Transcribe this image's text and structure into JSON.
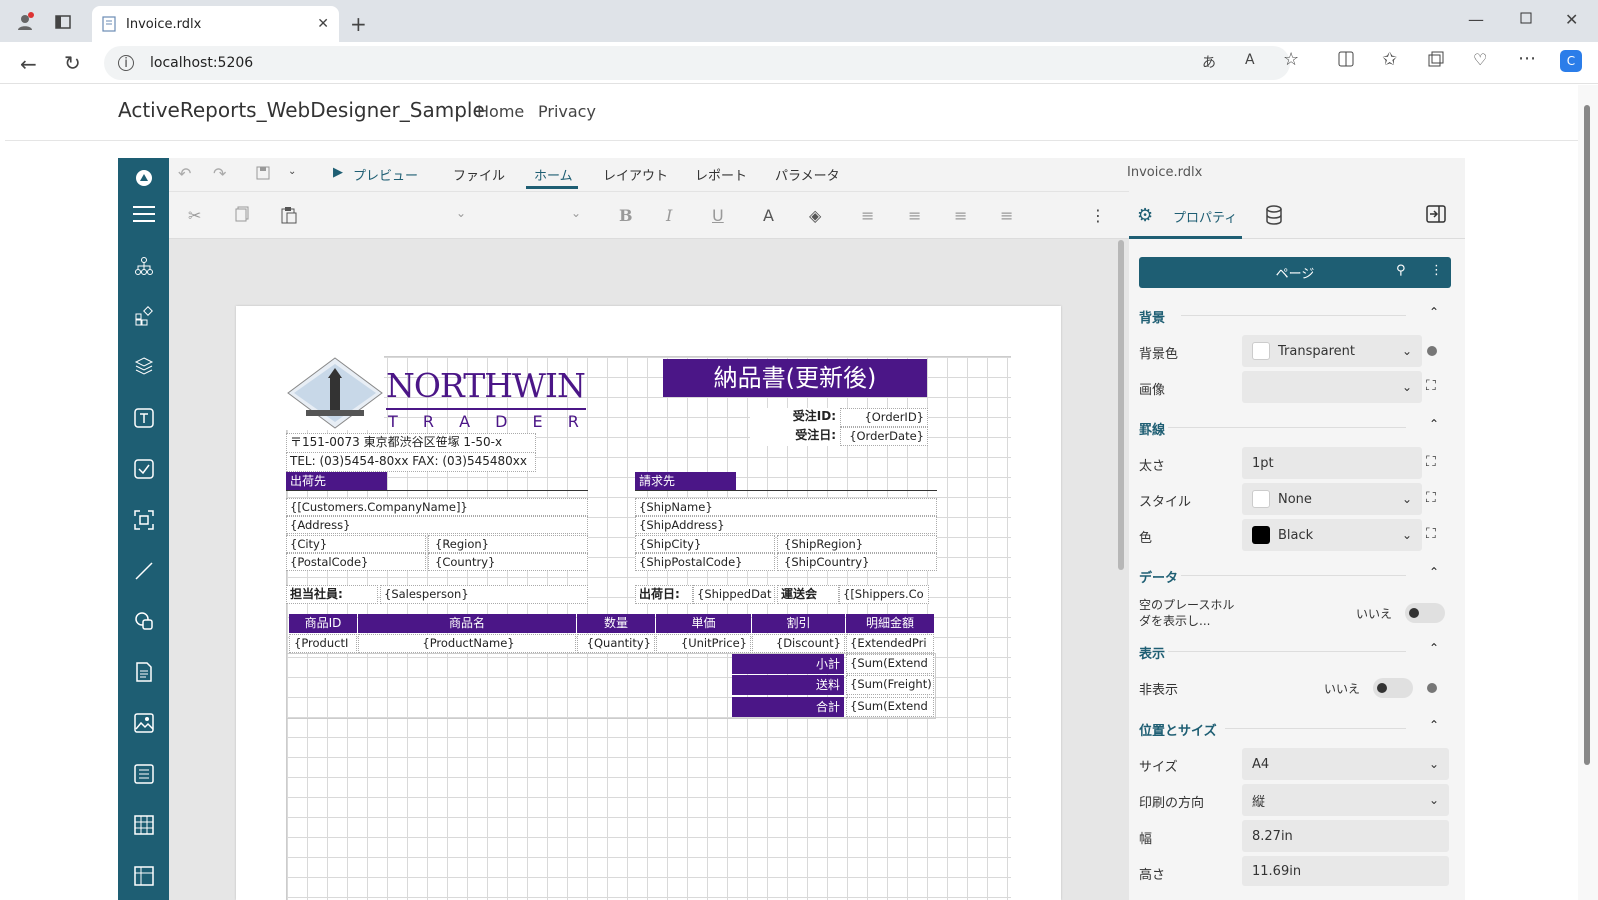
{
  "browser": {
    "tab_title": "Invoice.rdlx",
    "url": "localhost:5206"
  },
  "site": {
    "brand": "ActiveReports_WebDesigner_Sample",
    "nav": [
      "Home",
      "Privacy"
    ]
  },
  "designer": {
    "file_name": "Invoice.rdlx",
    "preview": "プレビュー",
    "menu": [
      "ファイル",
      "ホーム",
      "レイアウト",
      "レポート",
      "パラメータ"
    ],
    "active_menu": "ホーム",
    "properties_tab": "プロパティ"
  },
  "report": {
    "title": "納品書(更新後)",
    "logo_main": "NORTHWIND",
    "logo_sub": "T R A D E R S",
    "address": "〒151-0073 東京都渋谷区笹塚 1-50-x",
    "tel": "TEL: (03)5454-80xx FAX: (03)545480xx",
    "order_id_label": "受注ID:",
    "order_id": "{OrderID}",
    "order_date_label": "受注日:",
    "order_date": "{OrderDate}",
    "ship_to": "出荷先",
    "bill_to": "請求先",
    "company": "{[Customers.CompanyName]}",
    "addr": "{Address}",
    "city": "{City}",
    "region": "{Region}",
    "postal": "{PostalCode}",
    "country": "{Country}",
    "ship_name": "{ShipName}",
    "ship_address": "{ShipAddress}",
    "ship_city": "{ShipCity}",
    "ship_region": "{ShipRegion}",
    "ship_postal": "{ShipPostalCode}",
    "ship_country": "{ShipCountry}",
    "salesperson_label": "担当社員:",
    "salesperson": "{Salesperson}",
    "shipped_label": "出荷日:",
    "shipped": "{ShippedDat",
    "shipper_label": "運送会",
    "shipper": "{[Shippers.Co",
    "columns": [
      "商品ID",
      "商品名",
      "数量",
      "単価",
      "割引",
      "明細金額"
    ],
    "cells": [
      "{ProductI",
      "{ProductName}",
      "{Quantity}",
      "{UnitPrice}",
      "{Discount}",
      "{ExtendedPri"
    ],
    "subtotal_label": "小計",
    "subtotal": "{Sum(Extend",
    "freight_label": "送料",
    "freight": "{Sum(Freight)",
    "total_label": "合計",
    "total": "{Sum(Extend"
  },
  "props": {
    "target": "ページ",
    "background_section": "背景",
    "bg_color_label": "背景色",
    "bg_color": "Transparent",
    "image_label": "画像",
    "border_section": "罫線",
    "width_label": "太さ",
    "width": "1pt",
    "style_label": "スタイル",
    "style": "None",
    "color_label": "色",
    "color": "Black",
    "data_section": "データ",
    "placeholder_label": "空のプレースホルダを表示し...",
    "placeholder_value": "いいえ",
    "display_section": "表示",
    "hidden_label": "非表示",
    "hidden_value": "いいえ",
    "pos_section": "位置とサイズ",
    "size_label": "サイズ",
    "size": "A4",
    "orient_label": "印刷の方向",
    "orient": "縦",
    "w_label": "幅",
    "w": "8.27in",
    "h_label": "高さ",
    "h": "11.69in"
  },
  "colors": {
    "sidebar": "#1e5e73",
    "report_accent": "#4b1687"
  }
}
